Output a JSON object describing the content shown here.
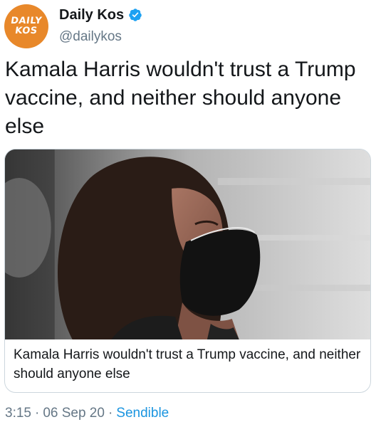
{
  "author": {
    "avatar_line1": "DAILY",
    "avatar_line2": "KOS",
    "display_name": "Daily Kos",
    "handle": "@dailykos",
    "verified": true
  },
  "tweet": {
    "text": "Kamala Harris wouldn't trust a Trump vaccine, and neither should anyone else"
  },
  "card": {
    "title": "Kamala Harris wouldn't trust a Trump vaccine, and neither should anyone else"
  },
  "meta": {
    "time": "3:15",
    "separator": "·",
    "date": "06 Sep 20",
    "source": "Sendible"
  },
  "colors": {
    "avatar_bg": "#e8882a",
    "verified_blue": "#1da1f2",
    "link_blue": "#1b95e0",
    "secondary_text": "#657786"
  },
  "icons": {
    "verified": "verified-badge-icon"
  }
}
